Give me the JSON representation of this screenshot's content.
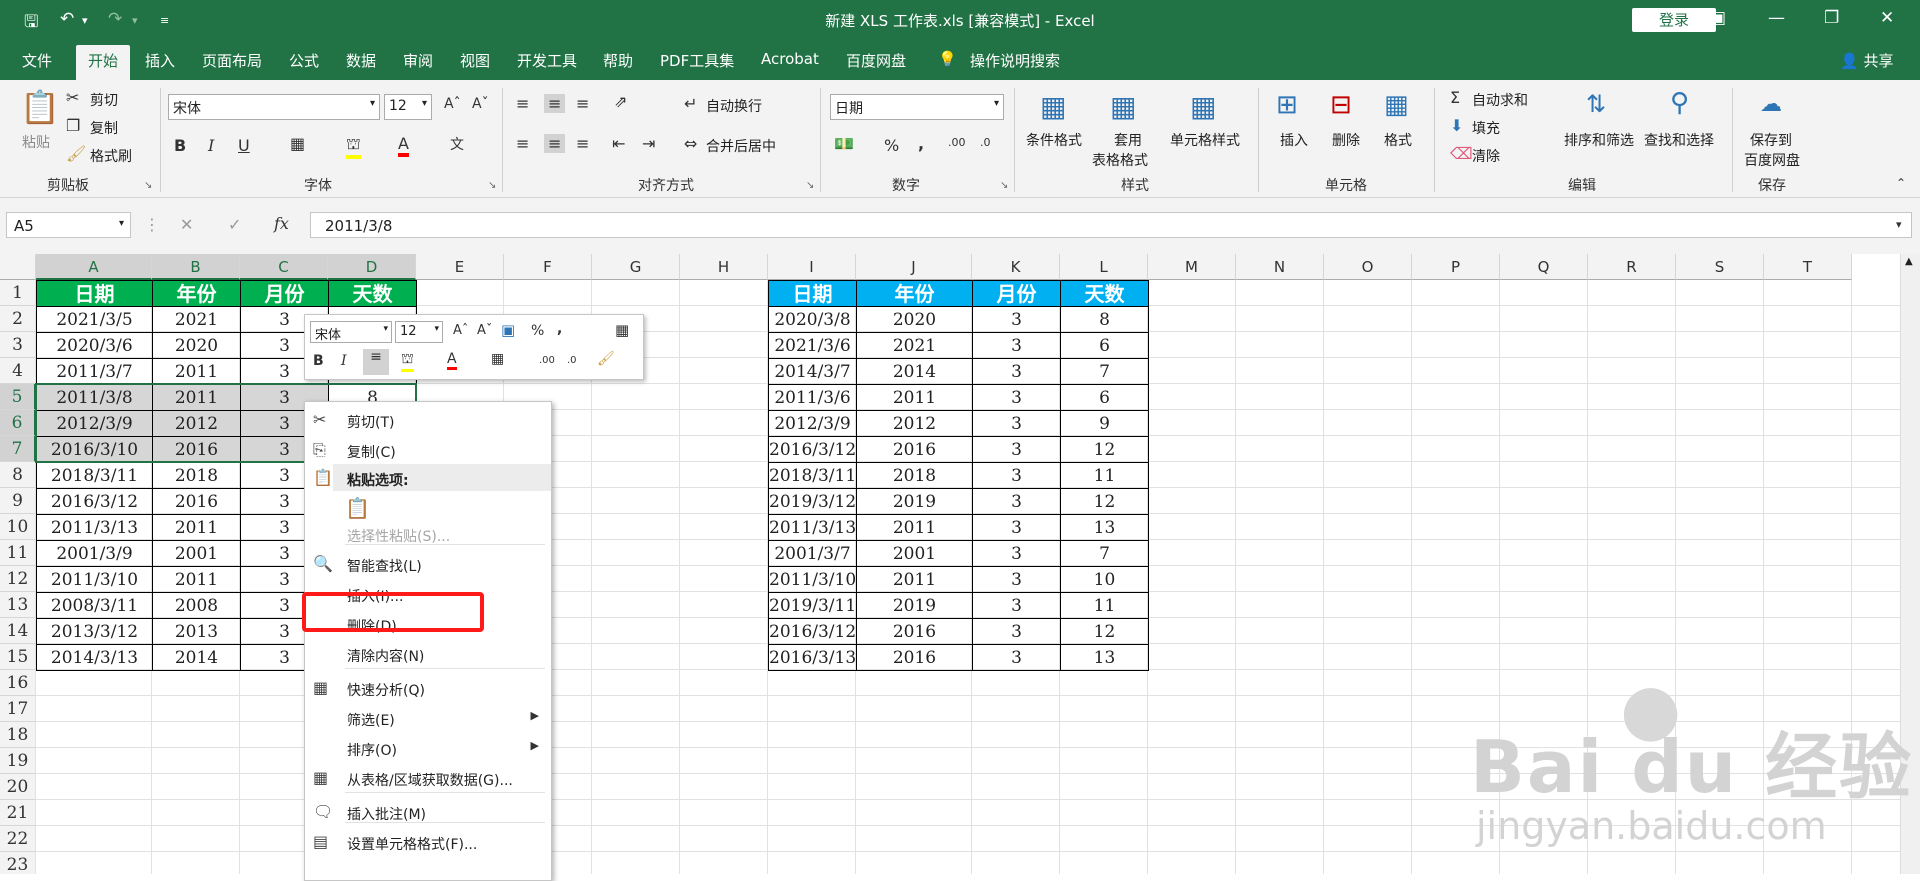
{
  "titlebar": {
    "title": "新建 XLS 工作表.xls  [兼容模式]  -  Excel",
    "login": "登录",
    "save_icon": "save-icon",
    "undo_icon": "undo-icon",
    "redo_icon": "redo-icon"
  },
  "tabs": [
    "文件",
    "开始",
    "插入",
    "页面布局",
    "公式",
    "数据",
    "审阅",
    "视图",
    "开发工具",
    "帮助",
    "PDF工具集",
    "Acrobat",
    "百度网盘"
  ],
  "tell_me": "操作说明搜索",
  "share": "共享",
  "ribbon": {
    "clipboard": {
      "paste": "粘贴",
      "cut": "剪切",
      "copy": "复制",
      "format_painter": "格式刷",
      "group": "剪贴板"
    },
    "font": {
      "name": "宋体",
      "size": "12",
      "bold": "B",
      "italic": "I",
      "underline": "U",
      "group": "字体"
    },
    "align": {
      "wrap": "自动换行",
      "merge": "合并后居中",
      "group": "对齐方式"
    },
    "number": {
      "format": "日期",
      "group": "数字"
    },
    "styles": {
      "cond": "条件格式",
      "table1": "套用",
      "table2": "表格格式",
      "cell": "单元格样式",
      "group": "样式"
    },
    "cells": {
      "insert": "插入",
      "delete": "删除",
      "format": "格式",
      "group": "单元格"
    },
    "edit": {
      "autosum": "自动求和",
      "fill": "填充",
      "clear": "清除",
      "sort": "排序和筛选",
      "find": "查找和选择",
      "group": "编辑"
    },
    "save": {
      "line1": "保存到",
      "line2": "百度网盘",
      "group": "保存"
    }
  },
  "formula_bar": {
    "name_box": "A5",
    "formula": "2011/3/8"
  },
  "columns": [
    "A",
    "B",
    "C",
    "D",
    "E",
    "F",
    "G",
    "H",
    "I",
    "J",
    "K",
    "L",
    "M",
    "N",
    "O",
    "P",
    "Q",
    "R",
    "S",
    "T"
  ],
  "rows": [
    "1",
    "2",
    "3",
    "4",
    "5",
    "6",
    "7",
    "8",
    "9",
    "10",
    "11",
    "12",
    "13",
    "14",
    "15",
    "16",
    "17",
    "18",
    "19",
    "20",
    "21",
    "22",
    "23"
  ],
  "left_table": {
    "headers": [
      "日期",
      "年份",
      "月份",
      "天数"
    ],
    "rows": [
      [
        "2021/3/5",
        "2021",
        "3",
        ""
      ],
      [
        "2020/3/6",
        "2020",
        "3",
        ""
      ],
      [
        "2011/3/7",
        "2011",
        "3",
        ""
      ],
      [
        "2011/3/8",
        "2011",
        "3",
        "8"
      ],
      [
        "2012/3/9",
        "2012",
        "3",
        ""
      ],
      [
        "2016/3/10",
        "2016",
        "3",
        ""
      ],
      [
        "2018/3/11",
        "2018",
        "3",
        ""
      ],
      [
        "2016/3/12",
        "2016",
        "3",
        ""
      ],
      [
        "2011/3/13",
        "2011",
        "3",
        ""
      ],
      [
        "2001/3/9",
        "2001",
        "3",
        ""
      ],
      [
        "2011/3/10",
        "2011",
        "3",
        ""
      ],
      [
        "2008/3/11",
        "2008",
        "3",
        ""
      ],
      [
        "2013/3/12",
        "2013",
        "3",
        ""
      ],
      [
        "2014/3/13",
        "2014",
        "3",
        ""
      ]
    ],
    "header_color": "#00b050"
  },
  "right_table": {
    "headers": [
      "日期",
      "年份",
      "月份",
      "天数"
    ],
    "rows": [
      [
        "2020/3/8",
        "2020",
        "3",
        "8"
      ],
      [
        "2021/3/6",
        "2021",
        "3",
        "6"
      ],
      [
        "2014/3/7",
        "2014",
        "3",
        "7"
      ],
      [
        "2011/3/6",
        "2011",
        "3",
        "6"
      ],
      [
        "2012/3/9",
        "2012",
        "3",
        "9"
      ],
      [
        "2016/3/12",
        "2016",
        "3",
        "12"
      ],
      [
        "2018/3/11",
        "2018",
        "3",
        "11"
      ],
      [
        "2019/3/12",
        "2019",
        "3",
        "12"
      ],
      [
        "2011/3/13",
        "2011",
        "3",
        "13"
      ],
      [
        "2001/3/7",
        "2001",
        "3",
        "7"
      ],
      [
        "2011/3/10",
        "2011",
        "3",
        "10"
      ],
      [
        "2019/3/11",
        "2019",
        "3",
        "11"
      ],
      [
        "2016/3/12",
        "2016",
        "3",
        "12"
      ],
      [
        "2016/3/13",
        "2016",
        "3",
        "13"
      ]
    ],
    "header_color": "#00b0f0"
  },
  "mini_toolbar": {
    "font": "宋体",
    "size": "12"
  },
  "context_menu": [
    {
      "label": "剪切(T)",
      "icon": "scissors-icon"
    },
    {
      "label": "复制(C)",
      "icon": "copy-icon"
    },
    {
      "label": "粘贴选项:",
      "icon": "paste-icon",
      "header": true
    },
    {
      "label": "选择性粘贴(S)...",
      "disabled": true
    },
    {
      "label": "智能查找(L)",
      "icon": "smart-lookup-icon"
    },
    {
      "label": "插入(I)...",
      "highlight": true
    },
    {
      "label": "删除(D)..."
    },
    {
      "label": "清除内容(N)"
    },
    {
      "label": "快速分析(Q)",
      "icon": "quick-analysis-icon"
    },
    {
      "label": "筛选(E)",
      "submenu": true
    },
    {
      "label": "排序(O)",
      "submenu": true
    },
    {
      "label": "从表格/区域获取数据(G)...",
      "icon": "table-icon"
    },
    {
      "label": "插入批注(M)",
      "icon": "comment-icon"
    },
    {
      "label": "设置单元格格式(F)...",
      "icon": "format-cells-icon"
    }
  ],
  "watermark": {
    "brand": "Bai du 经验",
    "url": "jingyan.baidu.com"
  }
}
